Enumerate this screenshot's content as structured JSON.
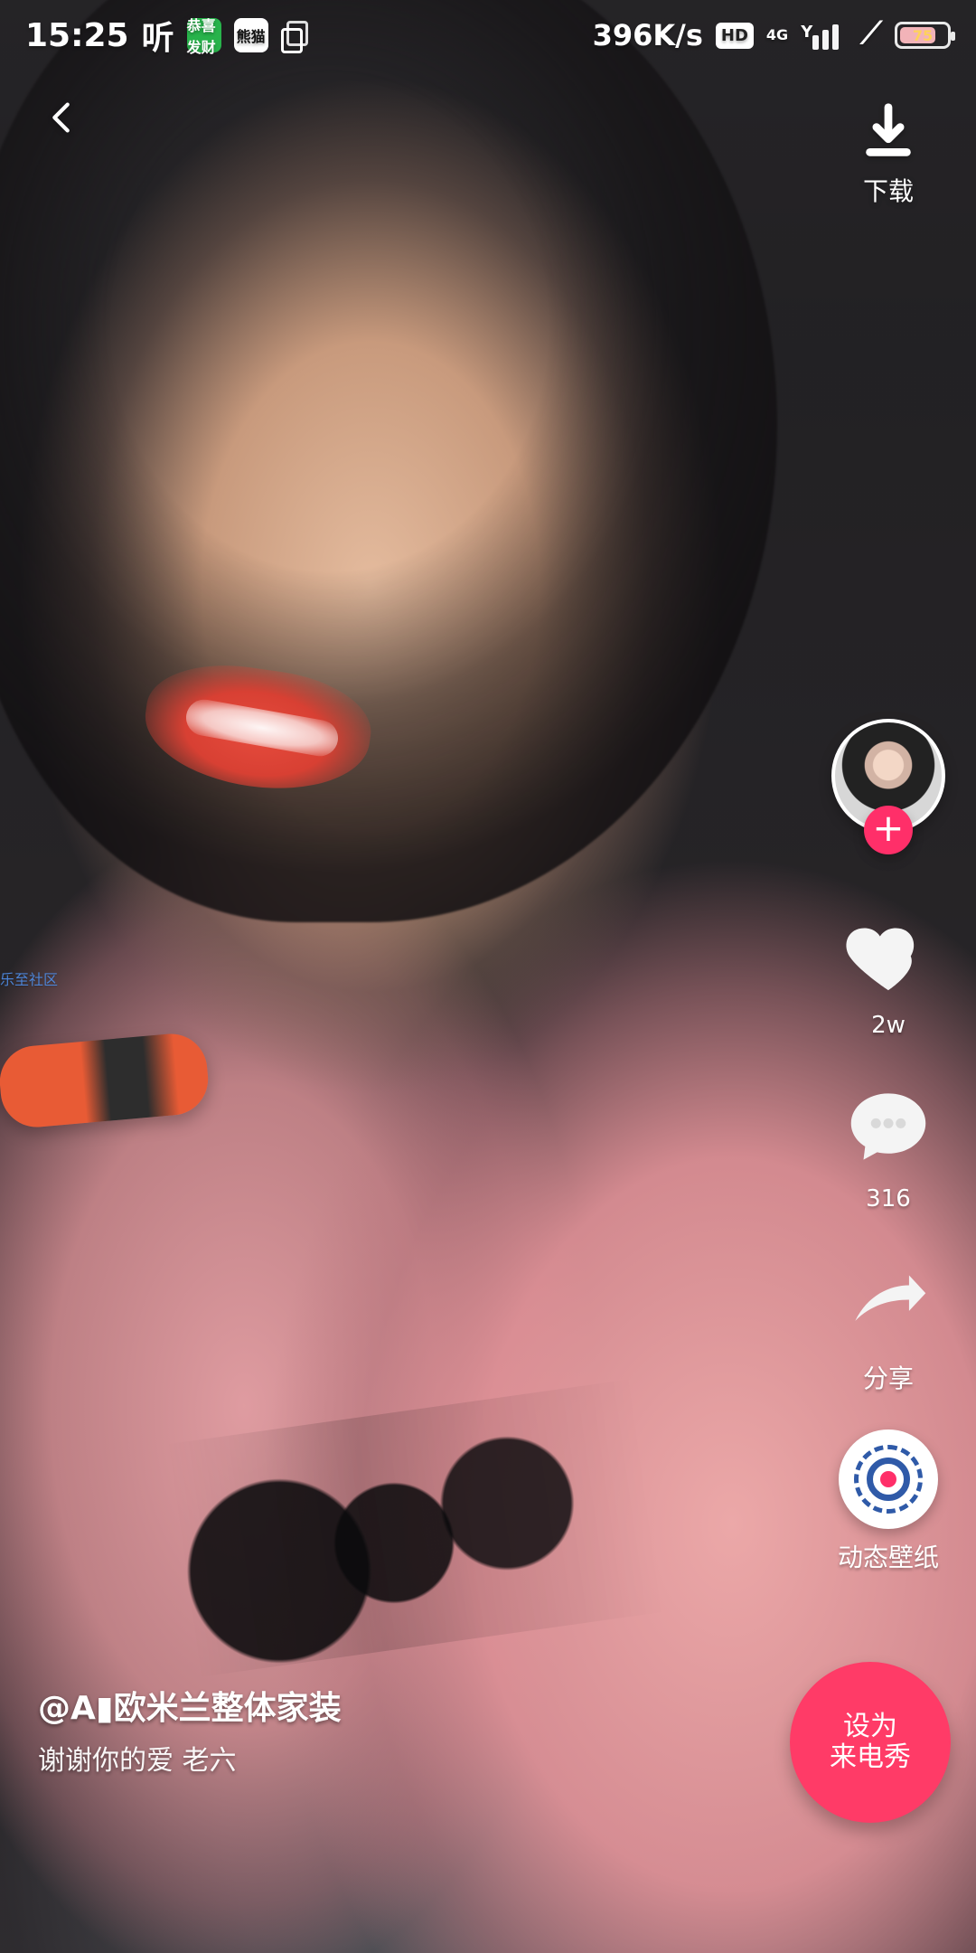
{
  "status_bar": {
    "time": "15:25",
    "listen": "听",
    "mini_app_green": "恭喜发财",
    "mini_app_panda": "熊猫",
    "net_speed": "396K/s",
    "hd": "HD",
    "network": "4G",
    "signal_prefix": "Y",
    "battery": "75"
  },
  "top": {
    "download_label": "下载"
  },
  "rail": {
    "likes": "2w",
    "comments": "316",
    "share_label": "分享",
    "wallpaper_label": "动态壁纸",
    "set_ring_line1": "设为",
    "set_ring_line2": "来电秀"
  },
  "caption": {
    "author": "@A▮欧米兰整体家装",
    "description": "谢谢你的爱 老六"
  },
  "watermark": {
    "text": "乐至社区"
  },
  "colors": {
    "accent_pink": "#ff2f69",
    "set_ring": "#ff3b67",
    "wallpaper_blue": "#2f5aa8"
  }
}
